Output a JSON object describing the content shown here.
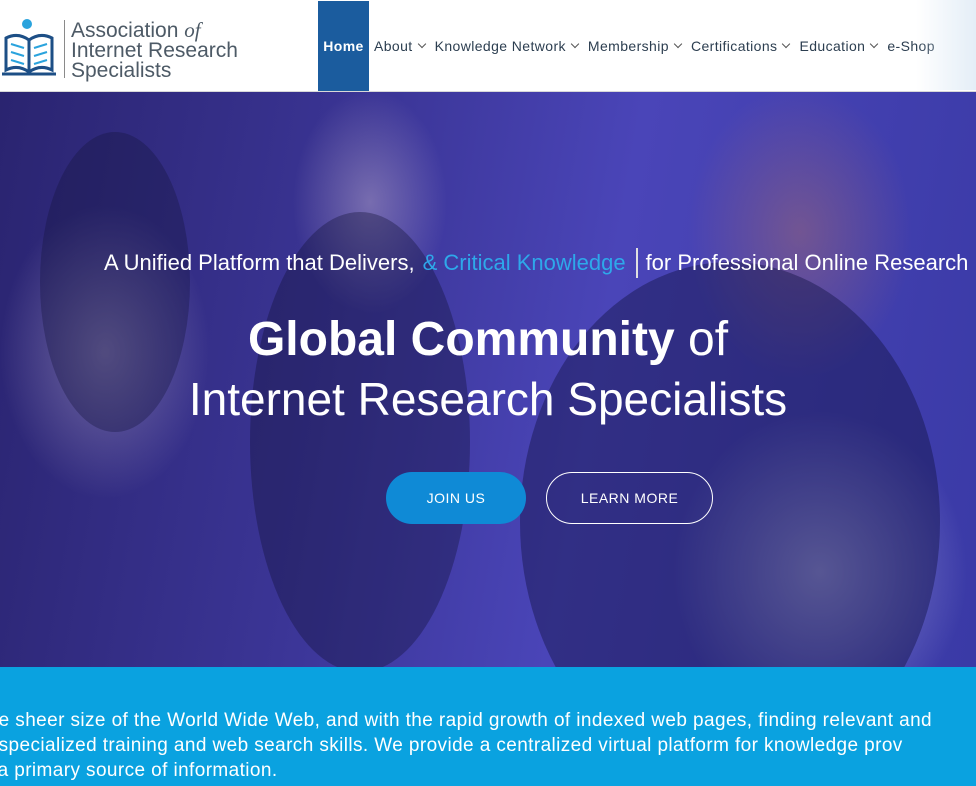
{
  "logo": {
    "line1": "Association",
    "line1_italic": "of",
    "line2": "Internet Research",
    "line3": "Specialists"
  },
  "nav": {
    "items": [
      {
        "label": "Home",
        "active": true,
        "has_dropdown": false
      },
      {
        "label": "About",
        "has_dropdown": true
      },
      {
        "label": "Knowledge Network",
        "has_dropdown": true
      },
      {
        "label": "Membership",
        "has_dropdown": true
      },
      {
        "label": "Certifications",
        "has_dropdown": true
      },
      {
        "label": "Education",
        "has_dropdown": true
      },
      {
        "label": "e-Shop",
        "has_dropdown": false
      }
    ]
  },
  "hero": {
    "tagline_start": "A Unified Platform that Delivers,",
    "tagline_accent": "& Critical Knowledge",
    "tagline_end": "for Professional Online Research",
    "title_bold": "Global Community",
    "title_rest": "of",
    "title_line2": "Internet Research Specialists",
    "join_label": "JOIN US",
    "learn_label": "LEARN MORE"
  },
  "intro": {
    "line1": "the sheer size of the World Wide Web, and with the rapid growth of indexed web pages, finding relevant and",
    "line2": "e specialized training and web search skills. We provide a centralized virtual platform for knowledge prov",
    "line3": "s a primary source of information."
  },
  "colors": {
    "nav_active": "#1b5c9e",
    "accent_blue": "#2ea8ea",
    "button_blue": "#0f8ad6",
    "intro_band": "#0aa2e0",
    "hero_overlay": "#3b3596"
  }
}
